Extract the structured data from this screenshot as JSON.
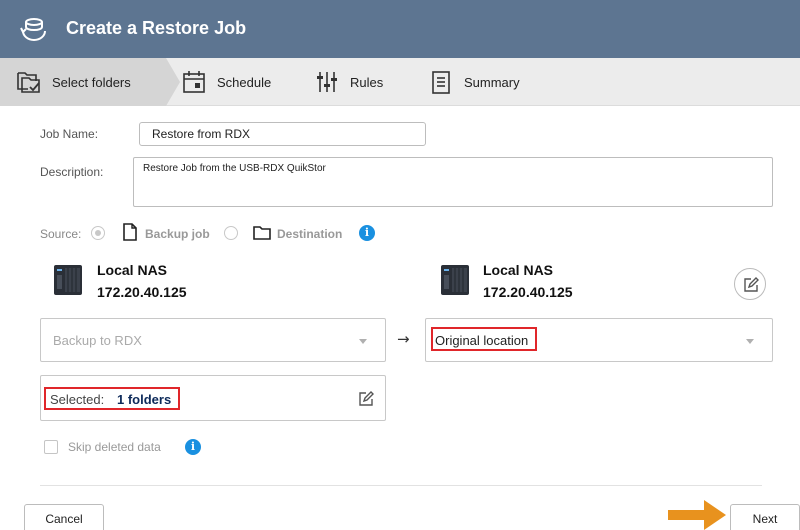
{
  "window": {
    "title": "Create a Restore Job",
    "icon": "restore-icon"
  },
  "steps": [
    {
      "label": "Select folders",
      "icon": "select-folders-icon",
      "active": true
    },
    {
      "label": "Schedule",
      "icon": "calendar-icon",
      "active": false
    },
    {
      "label": "Rules",
      "icon": "sliders-icon",
      "active": false
    },
    {
      "label": "Summary",
      "icon": "clipboard-icon",
      "active": false
    }
  ],
  "form": {
    "job_name_label": "Job Name:",
    "job_name_value": "Restore from RDX",
    "description_label": "Description:",
    "description_value": "Restore Job from the USB-RDX QuikStor",
    "source_label": "Source:",
    "source_options": [
      {
        "label": "Backup job",
        "icon": "file-icon",
        "selected": true
      },
      {
        "label": "Destination",
        "icon": "folder-icon",
        "selected": false
      }
    ]
  },
  "source_nas": {
    "name": "Local NAS",
    "ip": "172.20.40.125",
    "icon": "nas-device-icon"
  },
  "target_nas": {
    "name": "Local NAS",
    "ip": "172.20.40.125",
    "icon": "nas-device-icon"
  },
  "source_select": {
    "value": "Backup to RDX"
  },
  "arrow": "→",
  "target_select": {
    "value": "Original location"
  },
  "selected": {
    "label": "Selected:",
    "count": "1 folders"
  },
  "skip_deleted": {
    "label": "Skip deleted data",
    "checked": false
  },
  "buttons": {
    "cancel": "Cancel",
    "next": "Next"
  },
  "colors": {
    "titlebar": "#5d7591",
    "highlight": "#e0262a",
    "info": "#1a90e0",
    "pointer_arrow": "#e8921e"
  }
}
